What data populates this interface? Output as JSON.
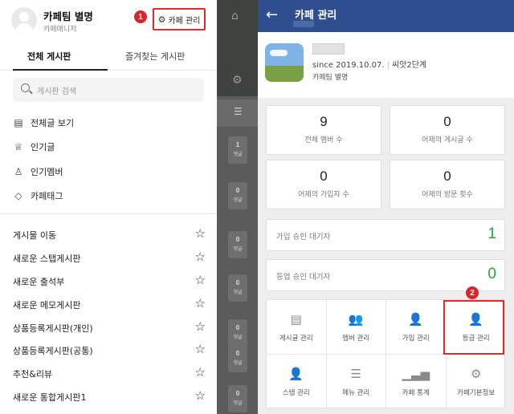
{
  "left_panel": {
    "cafe_name": "카페팀 별명",
    "cafe_role": "카페매니저",
    "manage_button": "카페 관리",
    "marker_1": "1",
    "tabs": [
      {
        "label": "전체 게시판",
        "active": true
      },
      {
        "label": "즐겨찾는 게시판",
        "active": false
      }
    ],
    "search_placeholder": "게시판 검색",
    "menu": [
      {
        "label": "전체글 보기",
        "icon": "document-list-icon"
      },
      {
        "label": "인기글",
        "icon": "trophy-icon"
      },
      {
        "label": "인기멤버",
        "icon": "medal-icon"
      },
      {
        "label": "카페태그",
        "icon": "tag-icon"
      }
    ],
    "boards": [
      "게시물 이동",
      "새로운 스탭게시판",
      "새로운 출석부",
      "새로운 메모게시판",
      "상품등록게시판(개인)",
      "상품등록게시판(공통)",
      "추천&리뷰",
      "새로운 통합게시판1"
    ]
  },
  "middle_strip": {
    "comment_label": "댓글",
    "counts": [
      "1",
      "0",
      "0",
      "0",
      "0",
      "0",
      "0"
    ]
  },
  "right_panel": {
    "title": "카페 관리",
    "since": "since  2019.10.07.",
    "level": "씨앗2단계",
    "role": "카페팀 별명",
    "stats": [
      {
        "value": "9",
        "label": "전체 멤버 수"
      },
      {
        "value": "0",
        "label": "어제의 게시글 수"
      },
      {
        "value": "0",
        "label": "어제의 가입자 수"
      },
      {
        "value": "0",
        "label": "어제의 방문 횟수"
      }
    ],
    "pending_join": {
      "label": "가입 승인 대기자",
      "value": "1"
    },
    "pending_grade": {
      "label": "등업 승인 대기자",
      "value": "0"
    },
    "marker_2": "2",
    "grid": [
      {
        "label": "게시글 관리",
        "icon": "board-icon"
      },
      {
        "label": "멤버 관리",
        "icon": "members-icon"
      },
      {
        "label": "가입 관리",
        "icon": "add-user-icon"
      },
      {
        "label": "등급 관리",
        "icon": "grade-user-icon"
      },
      {
        "label": "스탭 관리",
        "icon": "staff-icon"
      },
      {
        "label": "메뉴 관리",
        "icon": "menu-icon"
      },
      {
        "label": "카페 통계",
        "icon": "bar-chart-icon"
      },
      {
        "label": "카페기본정보",
        "icon": "gear-icon"
      }
    ],
    "accent_color": "#2f4e90",
    "value_color": "#1fa837",
    "highlight_color": "#e02a2a"
  }
}
